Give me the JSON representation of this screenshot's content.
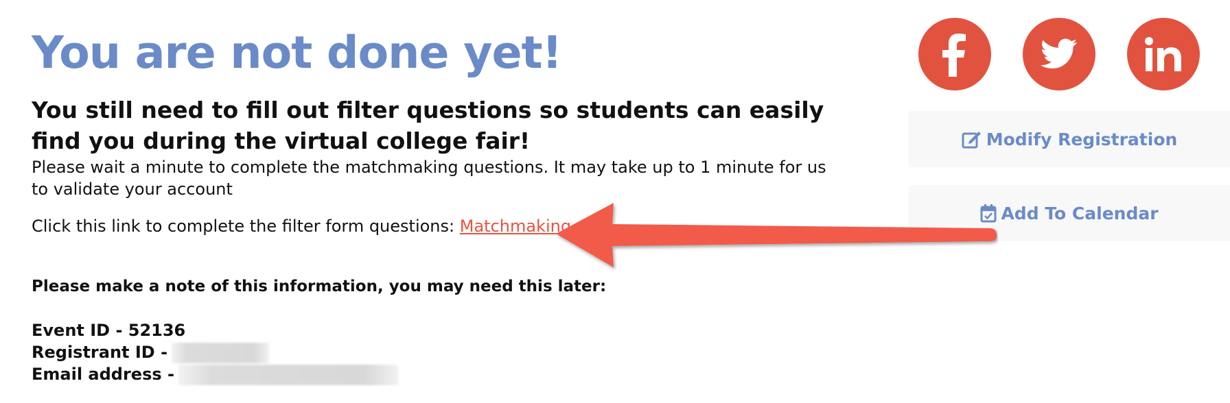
{
  "page": {
    "title": "You are not done yet!",
    "subtitle": "You still need to fill out filter questions so students can easily find you during the virtual college fair!",
    "wait_text": "Please wait a minute to complete the matchmaking questions. It may take up to 1 minute for us to validate your account",
    "click_text": "Click this link to complete the filter form questions: ",
    "link_label": "Matchmaking",
    "note": "Please make a note of this information, you may need this later:",
    "info": {
      "event_id": "Event ID - 52136",
      "registrant_label": "Registrant ID -",
      "email_label": "Email address -"
    }
  },
  "social": {
    "facebook_icon": "facebook-icon",
    "twitter_icon": "twitter-icon",
    "linkedin_icon": "linkedin-icon",
    "color": "#e1533f"
  },
  "sidebar": {
    "modify_label": "Modify Registration",
    "calendar_label": "Add To Calendar",
    "accent": "#6a8bc8"
  },
  "annotation": {
    "arrow_color": "#f25a4a"
  }
}
